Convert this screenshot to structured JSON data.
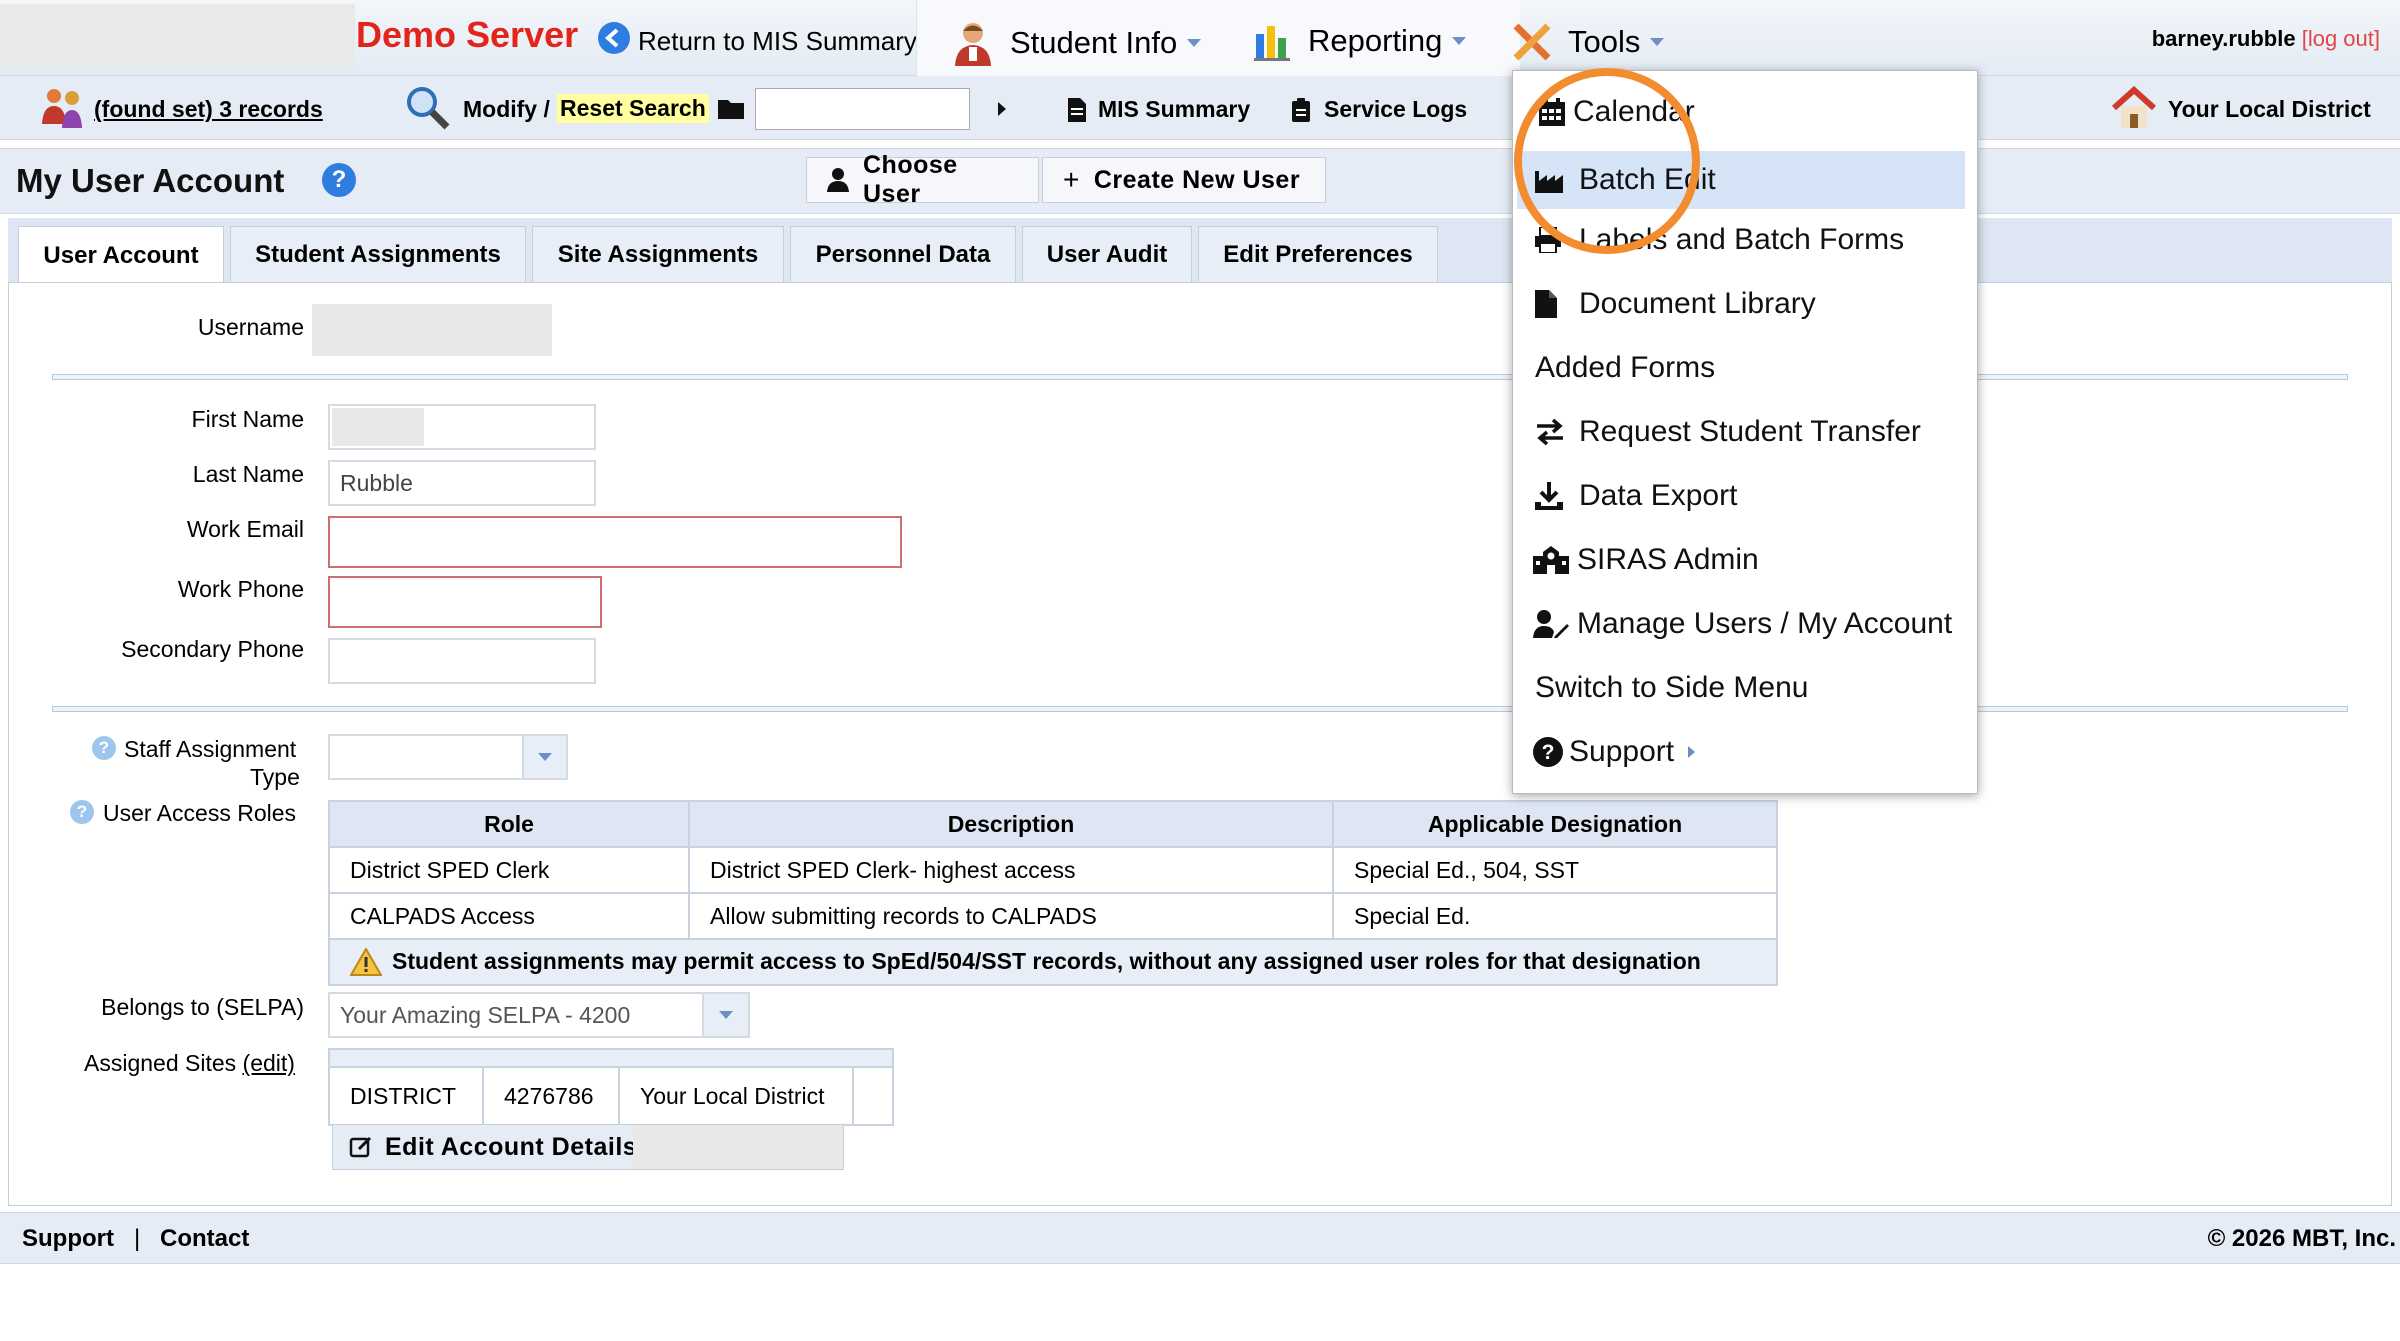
{
  "header": {
    "server_name": "Demo Server",
    "return_link": "Return to MIS Summary",
    "menus": [
      {
        "label": "Student Info"
      },
      {
        "label": "Reporting"
      },
      {
        "label": "Tools"
      }
    ],
    "username": "barney.rubble",
    "logout": "[log out]"
  },
  "toolbar": {
    "found_set": "(found set) 3 records",
    "modify": "Modify /",
    "reset_search": "Reset Search",
    "search_value": "",
    "mis_summary": "MIS Summary",
    "service_logs": "Service Logs",
    "district": "Your Local District"
  },
  "page": {
    "title": "My User Account",
    "help_glyph": "?",
    "choose_user": "Choose User",
    "create_new_user": "Create New User"
  },
  "tabs": [
    {
      "label": "User Account",
      "active": true
    },
    {
      "label": "Student Assignments"
    },
    {
      "label": "Site Assignments"
    },
    {
      "label": "Personnel Data"
    },
    {
      "label": "User Audit"
    },
    {
      "label": "Edit Preferences"
    }
  ],
  "form": {
    "username_label": "Username",
    "username_value": "",
    "first_name_label": "First Name",
    "first_name_value": "",
    "last_name_label": "Last Name",
    "last_name_value": "Rubble",
    "work_email_label": "Work Email",
    "work_email_value": "",
    "work_phone_label": "Work Phone",
    "work_phone_value": "",
    "secondary_phone_label": "Secondary Phone",
    "secondary_phone_value": "",
    "staff_assignment_label_1": "Staff Assignment",
    "staff_assignment_label_2": "Type",
    "staff_assignment_value": "",
    "user_access_roles_label": "User Access Roles",
    "belongs_label": "Belongs to (SELPA)",
    "belongs_value": "Your Amazing SELPA - 4200",
    "assigned_sites_label": "Assigned Sites",
    "assigned_sites_edit": "(edit)",
    "edit_button": "Edit Account Details"
  },
  "roles_table": {
    "headers": [
      "Role",
      "Description",
      "Applicable Designation"
    ],
    "rows": [
      [
        "District SPED Clerk",
        "District SPED Clerk- highest access",
        "Special Ed., 504, SST"
      ],
      [
        "CALPADS Access",
        "Allow submitting records to CALPADS",
        "Special Ed."
      ]
    ],
    "warning": "Student assignments may permit access to SpEd/504/SST records, without any assigned user roles for that designation"
  },
  "sites_table": {
    "rows": [
      [
        "DISTRICT",
        "4276786",
        "Your Local District",
        ""
      ]
    ]
  },
  "footer": {
    "support": "Support",
    "separator": "|",
    "contact": "Contact",
    "copyright": "© 2026 MBT, Inc."
  },
  "tools_menu": {
    "items": [
      {
        "label": "Calendar",
        "icon": "calendar-icon"
      },
      {
        "label": "Batch Edit",
        "icon": "batch-edit-icon",
        "highlighted": true
      },
      {
        "label": "Labels and Batch Forms",
        "icon": "print-icon"
      },
      {
        "label": "Document Library",
        "icon": "document-icon"
      },
      {
        "label": "Added Forms",
        "icon": ""
      },
      {
        "label": "Request Student Transfer",
        "icon": "transfer-icon"
      },
      {
        "label": "Data Export",
        "icon": "download-icon"
      },
      {
        "label": "SIRAS Admin",
        "icon": "school-icon"
      },
      {
        "label": "Manage Users / My Account",
        "icon": "user-edit-icon"
      },
      {
        "label": "Switch to Side Menu",
        "icon": ""
      },
      {
        "label": "Support",
        "icon": "question-circle-icon"
      }
    ]
  },
  "colors": {
    "server_name": "#e3241b",
    "highlight_circle": "#f28c2e",
    "menu_highlight": "#d6e4f7",
    "error_border": "#cc6f6f"
  }
}
